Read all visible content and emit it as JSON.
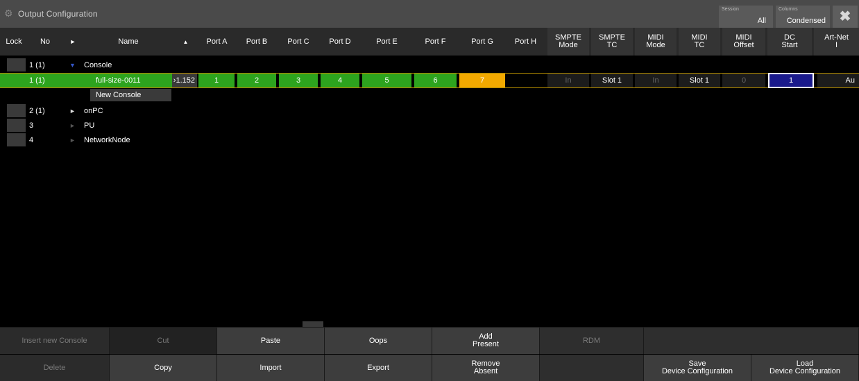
{
  "window": {
    "title": "Output Configuration"
  },
  "session": {
    "label": "Session",
    "value": "All"
  },
  "columns_toggle": {
    "label": "Columns",
    "value": "Condensed"
  },
  "close": {
    "glyph": "✖"
  },
  "headers": {
    "lock": "Lock",
    "no": "No",
    "expand": "►",
    "name": "Name",
    "sort": "▲",
    "port_a": "Port A",
    "port_b": "Port B",
    "port_c": "Port C",
    "port_d": "Port D",
    "port_e": "Port E",
    "port_f": "Port F",
    "port_g": "Port G",
    "port_h": "Port H",
    "smpte_mode": "SMPTE Mode",
    "smpte_tc": "SMPTE TC",
    "midi_mode": "MIDI Mode",
    "midi_tc": "MIDI TC",
    "midi_offset": "MIDI Offset",
    "dc_start": "DC Start",
    "artnet": "Art-Net I"
  },
  "rows": {
    "console": {
      "no": "1 (1)",
      "toggle": "▼",
      "name": "Console"
    },
    "device": {
      "no": "1 (1)",
      "name": "full-size-0011",
      "ip": "›1.152",
      "port_a": "1",
      "port_b": "2",
      "port_c": "3",
      "port_d": "4",
      "port_e": "5",
      "port_f": "6",
      "port_g": "7",
      "smpte_mode": "In",
      "smpte_tc": "Slot 1",
      "midi_mode": "In",
      "midi_tc": "Slot 1",
      "midi_offset": "0",
      "dc_start": "1",
      "artnet": "Au"
    },
    "new_console": "New Console",
    "onpc": {
      "no": "2 (1)",
      "toggle": "►",
      "name": "onPC"
    },
    "pu": {
      "no": "3",
      "toggle": "►",
      "name": "PU"
    },
    "networknode": {
      "no": "4",
      "toggle": "►",
      "name": "NetworkNode"
    }
  },
  "buttons": {
    "insert_new_console": "Insert new Console",
    "cut": "Cut",
    "paste": "Paste",
    "oops": "Oops",
    "add_present_1": "Add",
    "add_present_2": "Present",
    "rdm": "RDM",
    "delete": "Delete",
    "copy": "Copy",
    "import": "Import",
    "export": "Export",
    "remove_absent_1": "Remove",
    "remove_absent_2": "Absent",
    "save_1": "Save",
    "save_2": "Device Configuration",
    "load_1": "Load",
    "load_2": "Device Configuration"
  },
  "colors": {
    "port_green": "#2da41e",
    "port_orange": "#f2a900",
    "selection_outline": "#b08a00",
    "dc_start_bg": "#1a1a8c"
  }
}
